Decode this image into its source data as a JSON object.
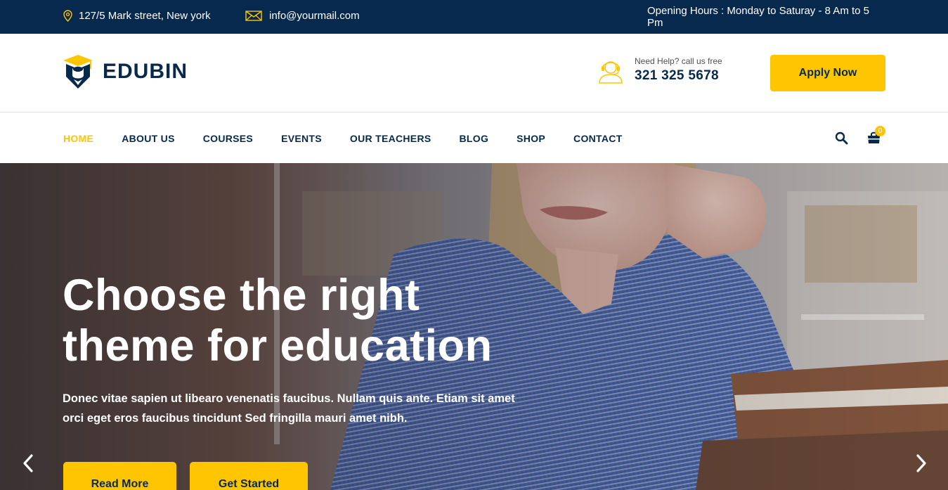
{
  "topbar": {
    "address": "127/5 Mark street, New york",
    "email": "info@yourmail.com",
    "hours": "Opening Hours : Monday to Saturay - 8 Am to 5 Pm",
    "address_icon": "map-pin-icon",
    "email_icon": "envelope-icon"
  },
  "header": {
    "logo_text": "EDUBIN",
    "help_label": "Need Help? call us free",
    "phone": "321 325 5678",
    "apply_label": "Apply Now"
  },
  "nav": {
    "items": [
      {
        "label": "HOME",
        "active": true
      },
      {
        "label": "ABOUT US",
        "active": false
      },
      {
        "label": "COURSES",
        "active": false
      },
      {
        "label": "EVENTS",
        "active": false
      },
      {
        "label": "OUR TEACHERS",
        "active": false
      },
      {
        "label": "BLOG",
        "active": false
      },
      {
        "label": "SHOP",
        "active": false
      },
      {
        "label": "CONTACT",
        "active": false
      }
    ],
    "cart_count": "0"
  },
  "hero": {
    "title_line1": "Choose the right",
    "title_line2": "theme for education",
    "subtitle_line1": "Donec vitae sapien ut libearo venenatis faucibus. Nullam quis ante. Etiam sit amet",
    "subtitle_line2": "orci eget eros faucibus tincidunt Sed fringilla mauri amet nibh.",
    "read_more_label": "Read More",
    "get_started_label": "Get Started"
  },
  "colors": {
    "navy": "#07294d",
    "yellow": "#ffc600",
    "white": "#ffffff"
  }
}
